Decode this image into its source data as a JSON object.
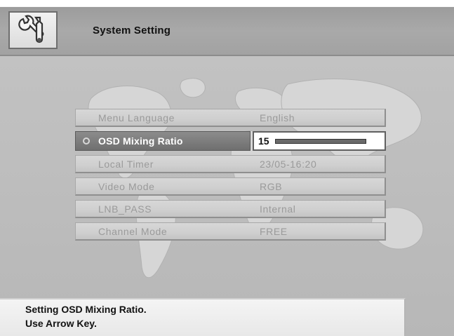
{
  "header": {
    "title": "System Setting",
    "icon": "wrench-screwdriver-icon"
  },
  "menu": {
    "items": [
      {
        "label": "Menu Language",
        "value": "English",
        "selected": false
      },
      {
        "label": "OSD Mixing Ratio",
        "value": "15",
        "selected": true,
        "level": 1.0
      },
      {
        "label": "Local Timer",
        "value": "23/05-16:20",
        "selected": false
      },
      {
        "label": "Video Mode",
        "value": "RGB",
        "selected": false
      },
      {
        "label": "LNB_PASS",
        "value": "Internal",
        "selected": false
      },
      {
        "label": "Channel Mode",
        "value": "FREE",
        "selected": false
      }
    ]
  },
  "status": {
    "line1": "Setting OSD Mixing Ratio.",
    "line2": "Use Arrow Key."
  },
  "colors": {
    "header_bar": "#a6a6a6",
    "background": "#c0c0c0",
    "selected_row": "#7a7a7a",
    "dim_text": "#9a9a9a"
  }
}
